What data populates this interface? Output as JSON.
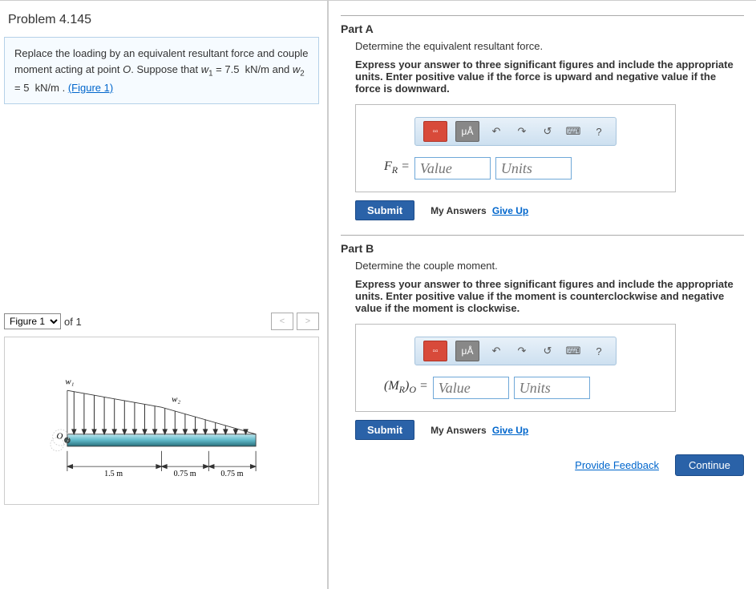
{
  "problem": {
    "number": "Problem 4.145",
    "statement_html": "Replace the loading by an equivalent resultant force and couple moment acting at point <i>O</i>. Suppose that <i>w</i><sub>1</sub> = 7.5&nbsp; kN/m and <i>w</i><sub>2</sub> = 5&nbsp; kN/m . ",
    "figure_link": "(Figure 1)"
  },
  "figureBar": {
    "selected": "Figure 1",
    "of_text": "of 1"
  },
  "figure": {
    "w1": "w₁",
    "w2": "w₂",
    "O": "O",
    "dim1": "1.5 m",
    "dim2": "0.75 m",
    "dim3": "0.75 m"
  },
  "partA": {
    "label": "Part A",
    "instruction": "Determine the equivalent resultant force.",
    "bold": "Express your answer to three significant figures and include the appropriate units. Enter positive value if the force is upward and negative value if the force is downward.",
    "var_html": "<i>F<sub>R</sub></i> =",
    "value_ph": "Value",
    "units_ph": "Units"
  },
  "partB": {
    "label": "Part B",
    "instruction": "Determine the couple moment.",
    "bold": "Express your answer to three significant figures and include the appropriate units. Enter positive value if the moment is counterclockwise and negative value if the moment is clockwise.",
    "var_html": "(<i>M<sub>R</sub></i>)<i><sub>O</sub></i> =",
    "value_ph": "Value",
    "units_ph": "Units"
  },
  "common": {
    "submit": "Submit",
    "my_answers": "My Answers",
    "give_up": "Give Up",
    "provide_feedback": "Provide Feedback",
    "continue": "Continue",
    "muA": "μÅ",
    "help": "?"
  }
}
